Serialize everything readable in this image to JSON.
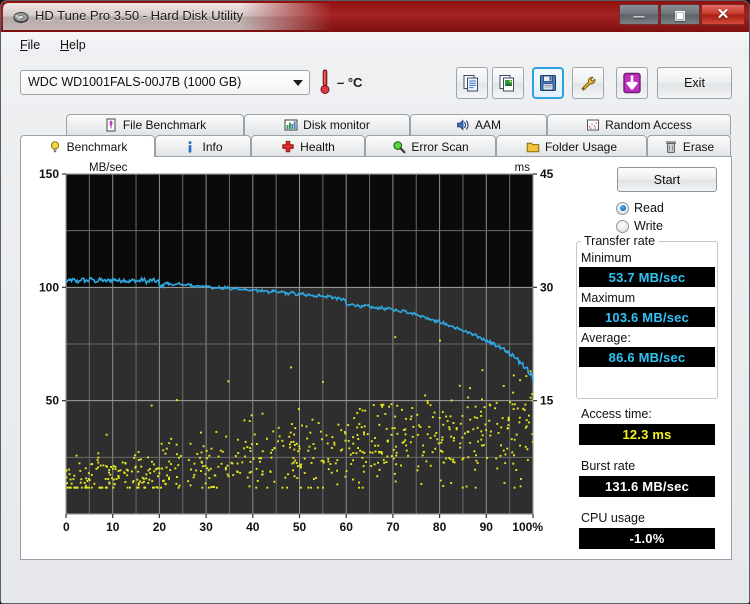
{
  "window": {
    "title": "HD Tune Pro 3.50 - Hard Disk Utility",
    "app_icon": "hard-disk-icon",
    "minimize_glyph": "—",
    "maximize_glyph": "▣",
    "close_glyph": "✕"
  },
  "menubar": {
    "items": [
      {
        "label": "File",
        "mnemonic": "F",
        "rest": "ile"
      },
      {
        "label": "Help",
        "mnemonic": "H",
        "rest": "elp"
      }
    ]
  },
  "toolbar": {
    "drive_selected": "WDC WD1001FALS-00J7B (1000 GB)",
    "drive_options": [
      "WDC WD1001FALS-00J7B (1000 GB)"
    ],
    "temperature": "– °C",
    "buttons": [
      {
        "name": "copy-text-button",
        "icon": "copy-text-icon"
      },
      {
        "name": "copy-image-button",
        "icon": "copy-image-icon"
      },
      {
        "name": "save-button",
        "icon": "floppy-save-icon",
        "selected": true
      },
      {
        "name": "options-button",
        "icon": "wrench-tools-icon"
      },
      {
        "name": "download-button",
        "icon": "download-arrow-icon"
      }
    ],
    "exit_label": "Exit"
  },
  "tabs": {
    "row1": [
      {
        "label": "File Benchmark",
        "icon": "file-benchmark-icon",
        "active": false
      },
      {
        "label": "Disk monitor",
        "icon": "bar-chart-icon",
        "active": false
      },
      {
        "label": "AAM",
        "icon": "speaker-icon",
        "active": false
      },
      {
        "label": "Random Access",
        "icon": "random-access-icon",
        "active": false
      }
    ],
    "row2": [
      {
        "label": "Benchmark",
        "icon": "lightbulb-icon",
        "active": true
      },
      {
        "label": "Info",
        "icon": "info-icon",
        "active": false
      },
      {
        "label": "Health",
        "icon": "red-cross-icon",
        "active": false
      },
      {
        "label": "Error Scan",
        "icon": "magnifier-icon",
        "active": false
      },
      {
        "label": "Folder Usage",
        "icon": "folder-icon",
        "active": false
      },
      {
        "label": "Erase",
        "icon": "trash-icon",
        "active": false
      }
    ]
  },
  "results": {
    "start_label": "Start",
    "mode_options": [
      {
        "label": "Read",
        "selected": true
      },
      {
        "label": "Write",
        "selected": false
      }
    ],
    "transfer_group_label": "Transfer rate",
    "minimum_label": "Minimum",
    "minimum_value": "53.7 MB/sec",
    "maximum_label": "Maximum",
    "maximum_value": "103.6 MB/sec",
    "average_label": "Average:",
    "average_value": "86.6 MB/sec",
    "access_time_label": "Access time:",
    "access_time_value": "12.3 ms",
    "burst_rate_label": "Burst rate",
    "burst_rate_value": "131.6 MB/sec",
    "cpu_usage_label": "CPU usage",
    "cpu_usage_value": "-1.0%"
  },
  "colors": {
    "transfer_line": "#2fa8e0",
    "access_points": "#e8e81e",
    "lcd_background": "#000000",
    "lcd_cyan": "#2fc3f5",
    "lcd_yellow": "#f2f21a",
    "lcd_white": "#ffffff",
    "titlebar_red": "#a52222",
    "save_highlight": "#2e9fe0"
  },
  "chart_data": {
    "type": "line",
    "title": "",
    "xlabel": "",
    "ylabel": "MB/sec",
    "y2label": "ms",
    "xlim": [
      0,
      100
    ],
    "ylim": [
      0,
      150
    ],
    "y2lim": [
      0,
      45
    ],
    "x_ticks": [
      0,
      10,
      20,
      30,
      40,
      50,
      60,
      70,
      80,
      90,
      100
    ],
    "x_tick_labels": [
      "0",
      "10",
      "20",
      "30",
      "40",
      "50",
      "60",
      "70",
      "80",
      "90",
      "100%"
    ],
    "y_ticks": [
      50,
      100,
      150
    ],
    "y_tick_labels": [
      "50",
      "100",
      "150"
    ],
    "y2_ticks": [
      15,
      30,
      45
    ],
    "y2_tick_labels": [
      "15",
      "30",
      "45"
    ],
    "grid": true,
    "grid_x_step": 5,
    "grid_y_step": 25,
    "legend": "none",
    "series": [
      {
        "name": "Transfer rate",
        "type": "line",
        "axis": "left",
        "unit": "MB/sec",
        "color": "#2fa8e0",
        "x": [
          0,
          1,
          2,
          3,
          4,
          5,
          6,
          7,
          8,
          9,
          10,
          11,
          12,
          13,
          14,
          15,
          16,
          17,
          18,
          19,
          20,
          21,
          22,
          23,
          24,
          25,
          26,
          27,
          28,
          29,
          30,
          31,
          32,
          33,
          34,
          35,
          36,
          37,
          38,
          39,
          40,
          41,
          42,
          43,
          44,
          45,
          46,
          47,
          48,
          49,
          50,
          51,
          52,
          53,
          54,
          55,
          56,
          57,
          58,
          59,
          60,
          61,
          62,
          63,
          64,
          65,
          66,
          67,
          68,
          69,
          70,
          71,
          72,
          73,
          74,
          75,
          76,
          77,
          78,
          79,
          80,
          81,
          82,
          83,
          84,
          85,
          86,
          87,
          88,
          89,
          90,
          91,
          92,
          93,
          94,
          95,
          96,
          97,
          98,
          99,
          100
        ],
        "values": [
          102.8,
          103.2,
          102.6,
          103.4,
          102.9,
          103.6,
          102.7,
          103.3,
          102.8,
          103.1,
          103.4,
          102.9,
          103.2,
          102.6,
          103.0,
          102.8,
          103.3,
          102.5,
          103.1,
          102.7,
          100.6,
          101.8,
          101.4,
          101.0,
          101.6,
          100.9,
          101.2,
          100.4,
          100.8,
          100.2,
          100.6,
          99.8,
          100.1,
          99.4,
          99.9,
          99.2,
          99.6,
          98.9,
          99.3,
          98.6,
          99.0,
          98.2,
          98.6,
          97.9,
          98.3,
          97.6,
          98.0,
          97.2,
          97.6,
          96.8,
          97.2,
          96.4,
          96.8,
          96.1,
          96.5,
          95.8,
          96.1,
          95.4,
          95.0,
          94.6,
          92.1,
          92.4,
          92.0,
          91.5,
          91.8,
          91.2,
          90.8,
          91.0,
          90.4,
          90.6,
          90.0,
          89.4,
          89.8,
          88.9,
          88.4,
          87.8,
          87.1,
          86.4,
          85.8,
          85.1,
          84.4,
          83.6,
          82.9,
          82.1,
          81.4,
          80.6,
          79.8,
          78.9,
          78.0,
          77.1,
          76.2,
          75.2,
          74.1,
          72.9,
          71.6,
          70.2,
          68.6,
          66.8,
          64.6,
          61.8,
          58.2,
          53.7
        ]
      },
      {
        "name": "Access time",
        "type": "scatter",
        "axis": "right",
        "unit": "ms",
        "color": "#e8e81e",
        "description": "Scatter cloud of random-access seek times, rising from ~4-13 ms near 0% to ~10-20 ms near 100%, with occasional outliers up to ~25 ms.",
        "min": 3.5,
        "max": 25.0,
        "average": 12.3,
        "point_count": 640
      }
    ]
  }
}
